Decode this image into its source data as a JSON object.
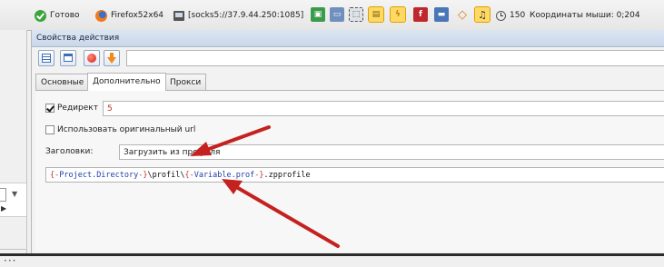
{
  "statusbar": {
    "ready": "Готово",
    "browser": "Firefox52x64",
    "proxy": "[socks5://37.9.44.250:1085]",
    "threads": "150",
    "mouse_coords": "Координаты мыши: 0;204"
  },
  "panel": {
    "title": "Свойства действия",
    "tabs": [
      "Основные",
      "Дополнительно",
      "Прокси"
    ],
    "active_tab": "Дополнительно",
    "redirect": {
      "label": "Редирект",
      "checked": true,
      "value": "5"
    },
    "original_url": {
      "label": "Использовать оригинальный url",
      "checked": false
    },
    "headers": {
      "label": "Заголовки:",
      "value": "Загрузить из профиля"
    },
    "path": {
      "tokens": [
        {
          "text": "{-",
          "kind": "brace"
        },
        {
          "text": "Project.Directory",
          "kind": "var"
        },
        {
          "text": "-}",
          "kind": "brace"
        },
        {
          "text": "\\profil\\",
          "kind": "plain"
        },
        {
          "text": "{-",
          "kind": "brace"
        },
        {
          "text": "Variable.prof",
          "kind": "var"
        },
        {
          "text": "-}",
          "kind": "brace"
        },
        {
          "text": ".zpprofile",
          "kind": "plain"
        }
      ]
    }
  },
  "leftpane": {
    "more": "···"
  },
  "colors": {
    "arrow": "#c4221e",
    "title_bar": "#c9d7ea",
    "accent_active": "#ffd966"
  },
  "icons": [
    "check-icon",
    "firefox-icon",
    "proxy-icon",
    "tool-icons",
    "clock-icon",
    "table-icon",
    "window-icon",
    "record-icon",
    "download-icon"
  ]
}
